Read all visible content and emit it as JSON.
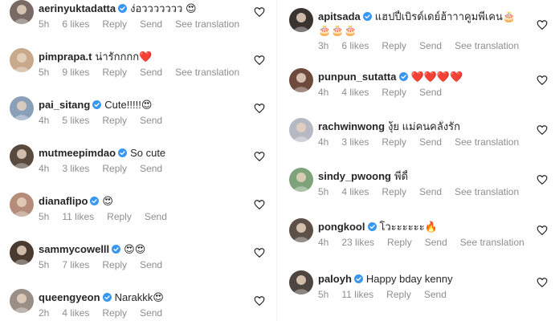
{
  "colors": {
    "text": "#262626",
    "meta": "#8e8e8e",
    "verified": "#3897f0",
    "heart_outline": "#262626"
  },
  "left_comments": [
    {
      "username": "aerinyuktadatta",
      "verified": true,
      "text": "ง่อววววววว 😍",
      "time": "5h",
      "likes": "6 likes",
      "reply": "Reply",
      "send": "Send",
      "translate": "See translation",
      "avatar_color": "#7a6a66"
    },
    {
      "username": "pimprapa.t",
      "verified": false,
      "text": "น่ารักกกก❤️",
      "time": "5h",
      "likes": "9 likes",
      "reply": "Reply",
      "send": "Send",
      "translate": "See translation",
      "avatar_color": "#c9a98c"
    },
    {
      "username": "pai_sitang",
      "verified": true,
      "text": "Cute!!!!!😍",
      "time": "4h",
      "likes": "5 likes",
      "reply": "Reply",
      "send": "Send",
      "translate": "",
      "avatar_color": "#8aa0b8"
    },
    {
      "username": "mutmeepimdao",
      "verified": true,
      "text": "So cute",
      "time": "4h",
      "likes": "3 likes",
      "reply": "Reply",
      "send": "Send",
      "translate": "",
      "avatar_color": "#5a4a3e"
    },
    {
      "username": "dianaflipo",
      "verified": true,
      "text": "😍",
      "time": "5h",
      "likes": "11 likes",
      "reply": "Reply",
      "send": "Send",
      "translate": "",
      "avatar_color": "#b58c7a"
    },
    {
      "username": "sammycowelll",
      "verified": true,
      "text": "😍😍",
      "time": "5h",
      "likes": "7 likes",
      "reply": "Reply",
      "send": "Send",
      "translate": "",
      "avatar_color": "#4a3a30"
    },
    {
      "username": "queengyeon",
      "verified": true,
      "text": "Narakkk😍",
      "time": "2h",
      "likes": "4 likes",
      "reply": "Reply",
      "send": "Send",
      "translate": "",
      "avatar_color": "#9a8f86"
    }
  ],
  "right_comments": [
    {
      "username": "apitsada",
      "verified": true,
      "text": "แฮปปี้เบิรด์เดย์ฮ้าาาคูมพี่เคน🎂",
      "text2": "🎂🎂🎂",
      "time": "3h",
      "likes": "6 likes",
      "reply": "Reply",
      "send": "Send",
      "translate": "See translation",
      "avatar_color": "#3a3330"
    },
    {
      "username": "punpun_sutatta",
      "verified": true,
      "text": "❤️❤️❤️❤️",
      "time": "4h",
      "likes": "4 likes",
      "reply": "Reply",
      "send": "Send",
      "translate": "",
      "avatar_color": "#6e4a3c"
    },
    {
      "username": "rachwinwong",
      "verified": false,
      "text": "งุ้ย แม่คนคลั่งรัก",
      "time": "4h",
      "likes": "3 likes",
      "reply": "Reply",
      "send": "Send",
      "translate": "See translation",
      "avatar_color": "#b6b8c4"
    },
    {
      "username": "sindy_pwoong",
      "verified": false,
      "text": "พี่ดี้",
      "time": "5h",
      "likes": "4 likes",
      "reply": "Reply",
      "send": "Send",
      "translate": "See translation",
      "avatar_color": "#7ea37a"
    },
    {
      "username": "pongkool",
      "verified": true,
      "text": "โวะะะะะะ🔥",
      "time": "4h",
      "likes": "23 likes",
      "reply": "Reply",
      "send": "Send",
      "translate": "See translation",
      "avatar_color": "#5c5048"
    },
    {
      "username": "paloyh",
      "verified": true,
      "text": "Happy bday kenny",
      "time": "5h",
      "likes": "11 likes",
      "reply": "Reply",
      "send": "Send",
      "translate": "",
      "avatar_color": "#4e4440"
    }
  ]
}
